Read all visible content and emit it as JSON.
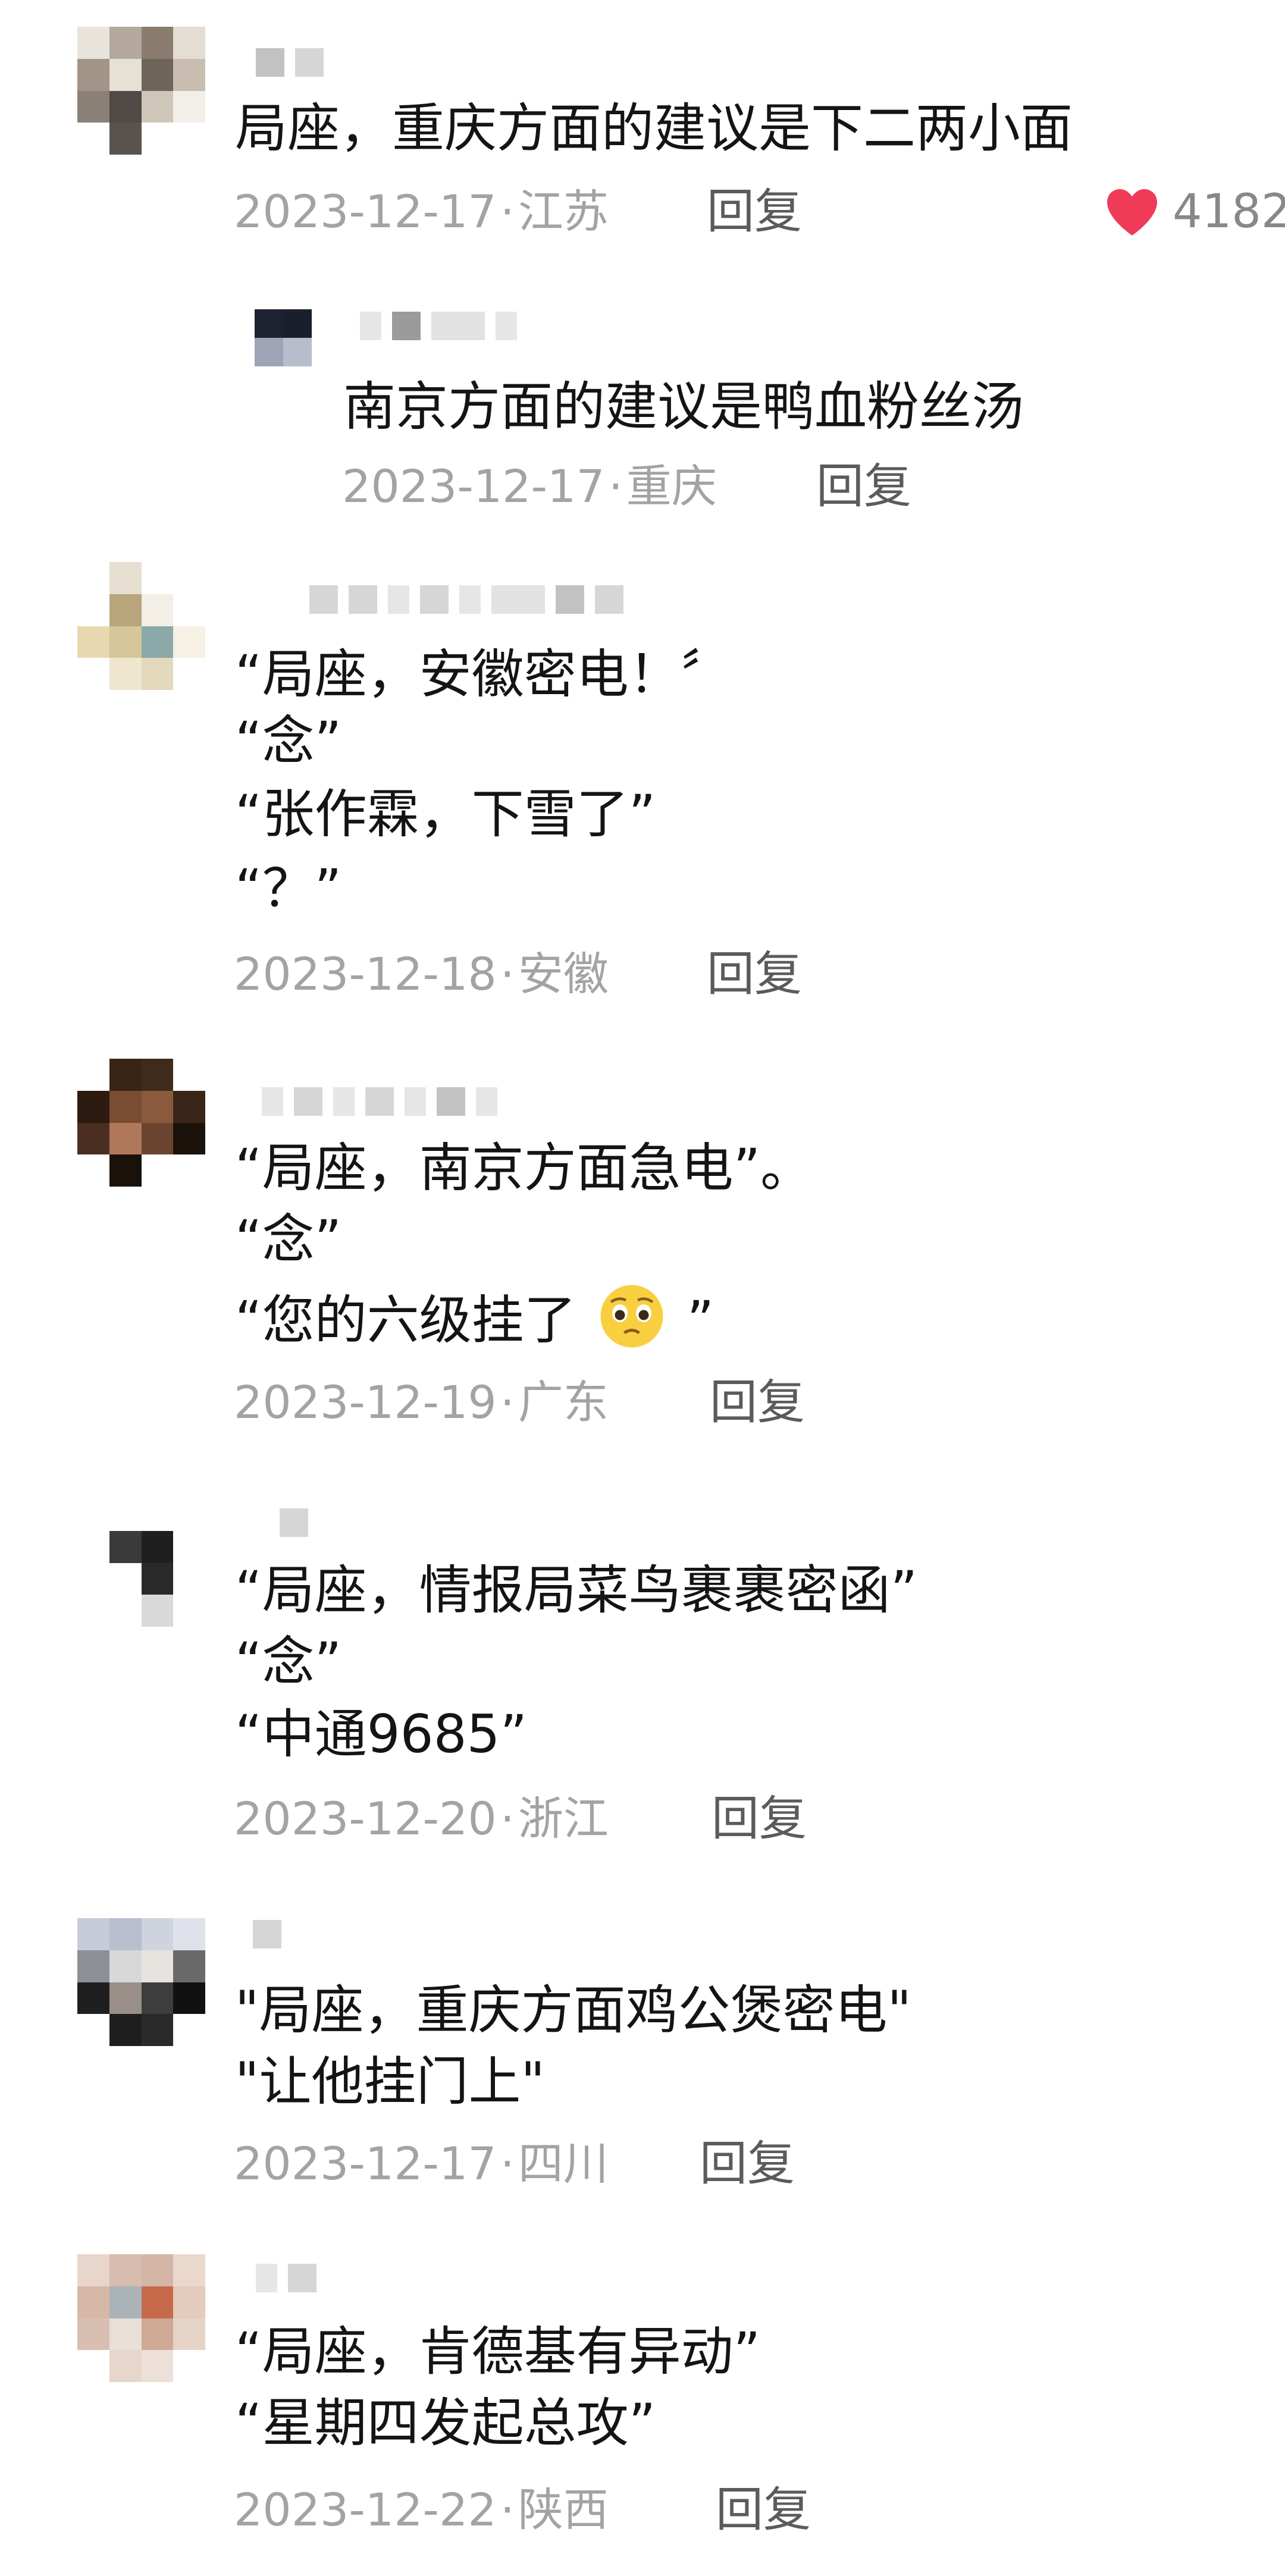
{
  "comments": [
    {
      "text": [
        "局座，重庆方面的建议是下二两小面"
      ],
      "date": "2023-12-17",
      "location": "江苏",
      "reply_label": "回复",
      "likes": "4182",
      "replies": [
        {
          "text": "南京方面的建议是鸭血粉丝汤",
          "date": "2023-12-17",
          "location": "重庆",
          "reply_label": "回复"
        }
      ]
    },
    {
      "text": [
        "“局座，安徽密电！〞",
        "“念”",
        "“张作霖，下雪了”",
        "“？”"
      ],
      "date": "2023-12-18",
      "location": "安徽",
      "reply_label": "回复"
    },
    {
      "text": [
        "“局座，南京方面急电”。",
        "“念”",
        "“您的六级挂了",
        "”"
      ],
      "emoji": "pleading-face-emoji",
      "date": "2023-12-19",
      "location": "广东",
      "reply_label": "回复"
    },
    {
      "text": [
        "“局座，情报局菜鸟裹裹密函”",
        "“念”",
        "“中通9685”"
      ],
      "date": "2023-12-20",
      "location": "浙江",
      "reply_label": "回复"
    },
    {
      "text": [
        "\"局座，重庆方面鸡公煲密电\"",
        "\"让他挂门上\""
      ],
      "date": "2023-12-17",
      "location": "四川",
      "reply_label": "回复"
    },
    {
      "text": [
        "“局座，肯德基有异动”",
        "“星期四发起总攻”"
      ],
      "date": "2023-12-22",
      "location": "陕西",
      "reply_label": "回复"
    }
  ],
  "colors": {
    "text": "#141414",
    "meta": "#a3a3a3",
    "reply": "#5b5b5b",
    "like_heart": "#ef3b58"
  },
  "icons": {
    "like": "heart-icon",
    "emoji": "pleading-face-emoji"
  }
}
